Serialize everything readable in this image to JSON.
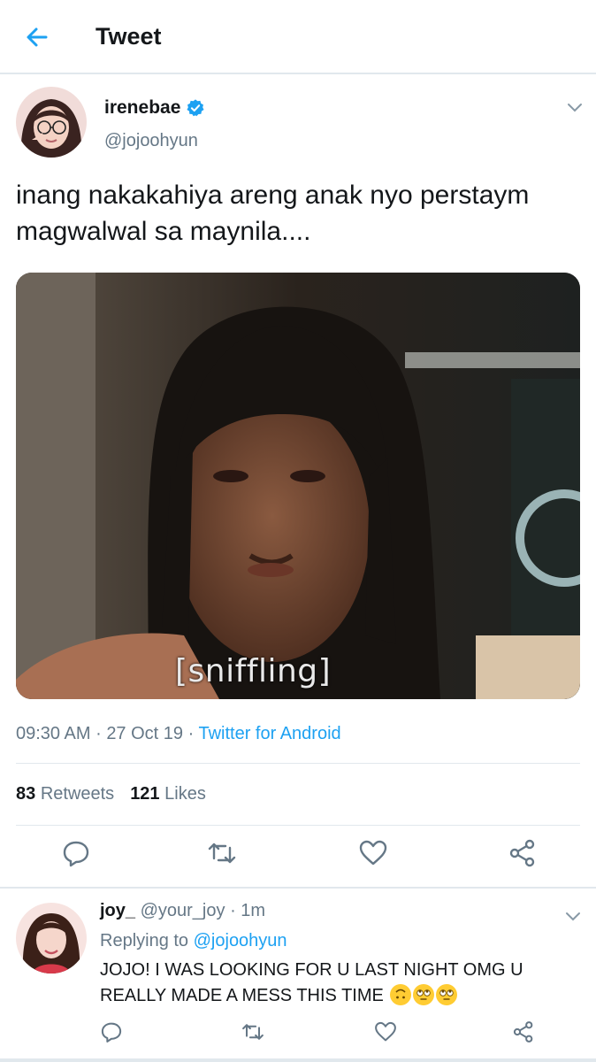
{
  "header": {
    "back_icon": "arrow-left-icon",
    "title": "Tweet"
  },
  "tweet": {
    "author_name": "irenebae",
    "verified": true,
    "handle": "@jojoohyun",
    "text": "inang nakakahiya areng anak nyo perstaym magwalwal sa maynila....",
    "media_caption": "[sniffling]",
    "time": "09:30 AM",
    "date": "27 Oct 19",
    "separator": "·",
    "source": "Twitter for Android",
    "retweets_count": "83",
    "retweets_label": "Retweets",
    "likes_count": "121",
    "likes_label": "Likes",
    "actions": [
      "reply-icon",
      "retweet-icon",
      "like-icon",
      "share-icon"
    ]
  },
  "reply": {
    "name": "joy_",
    "handle": "@your_joy",
    "separator": "·",
    "age": "1m",
    "replying_label": "Replying to",
    "replying_to": "@jojoohyun",
    "text": "JOJO! I WAS LOOKING FOR U LAST NIGHT OMG U REALLY MADE A MESS THIS TIME",
    "emojis": [
      "upside-down-face",
      "face-with-rolling-eyes",
      "face-with-rolling-eyes"
    ]
  },
  "colors": {
    "accent": "#1da1f2",
    "secondary_text": "#657786",
    "primary_text": "#14171a",
    "divider": "#e1e8ed"
  }
}
